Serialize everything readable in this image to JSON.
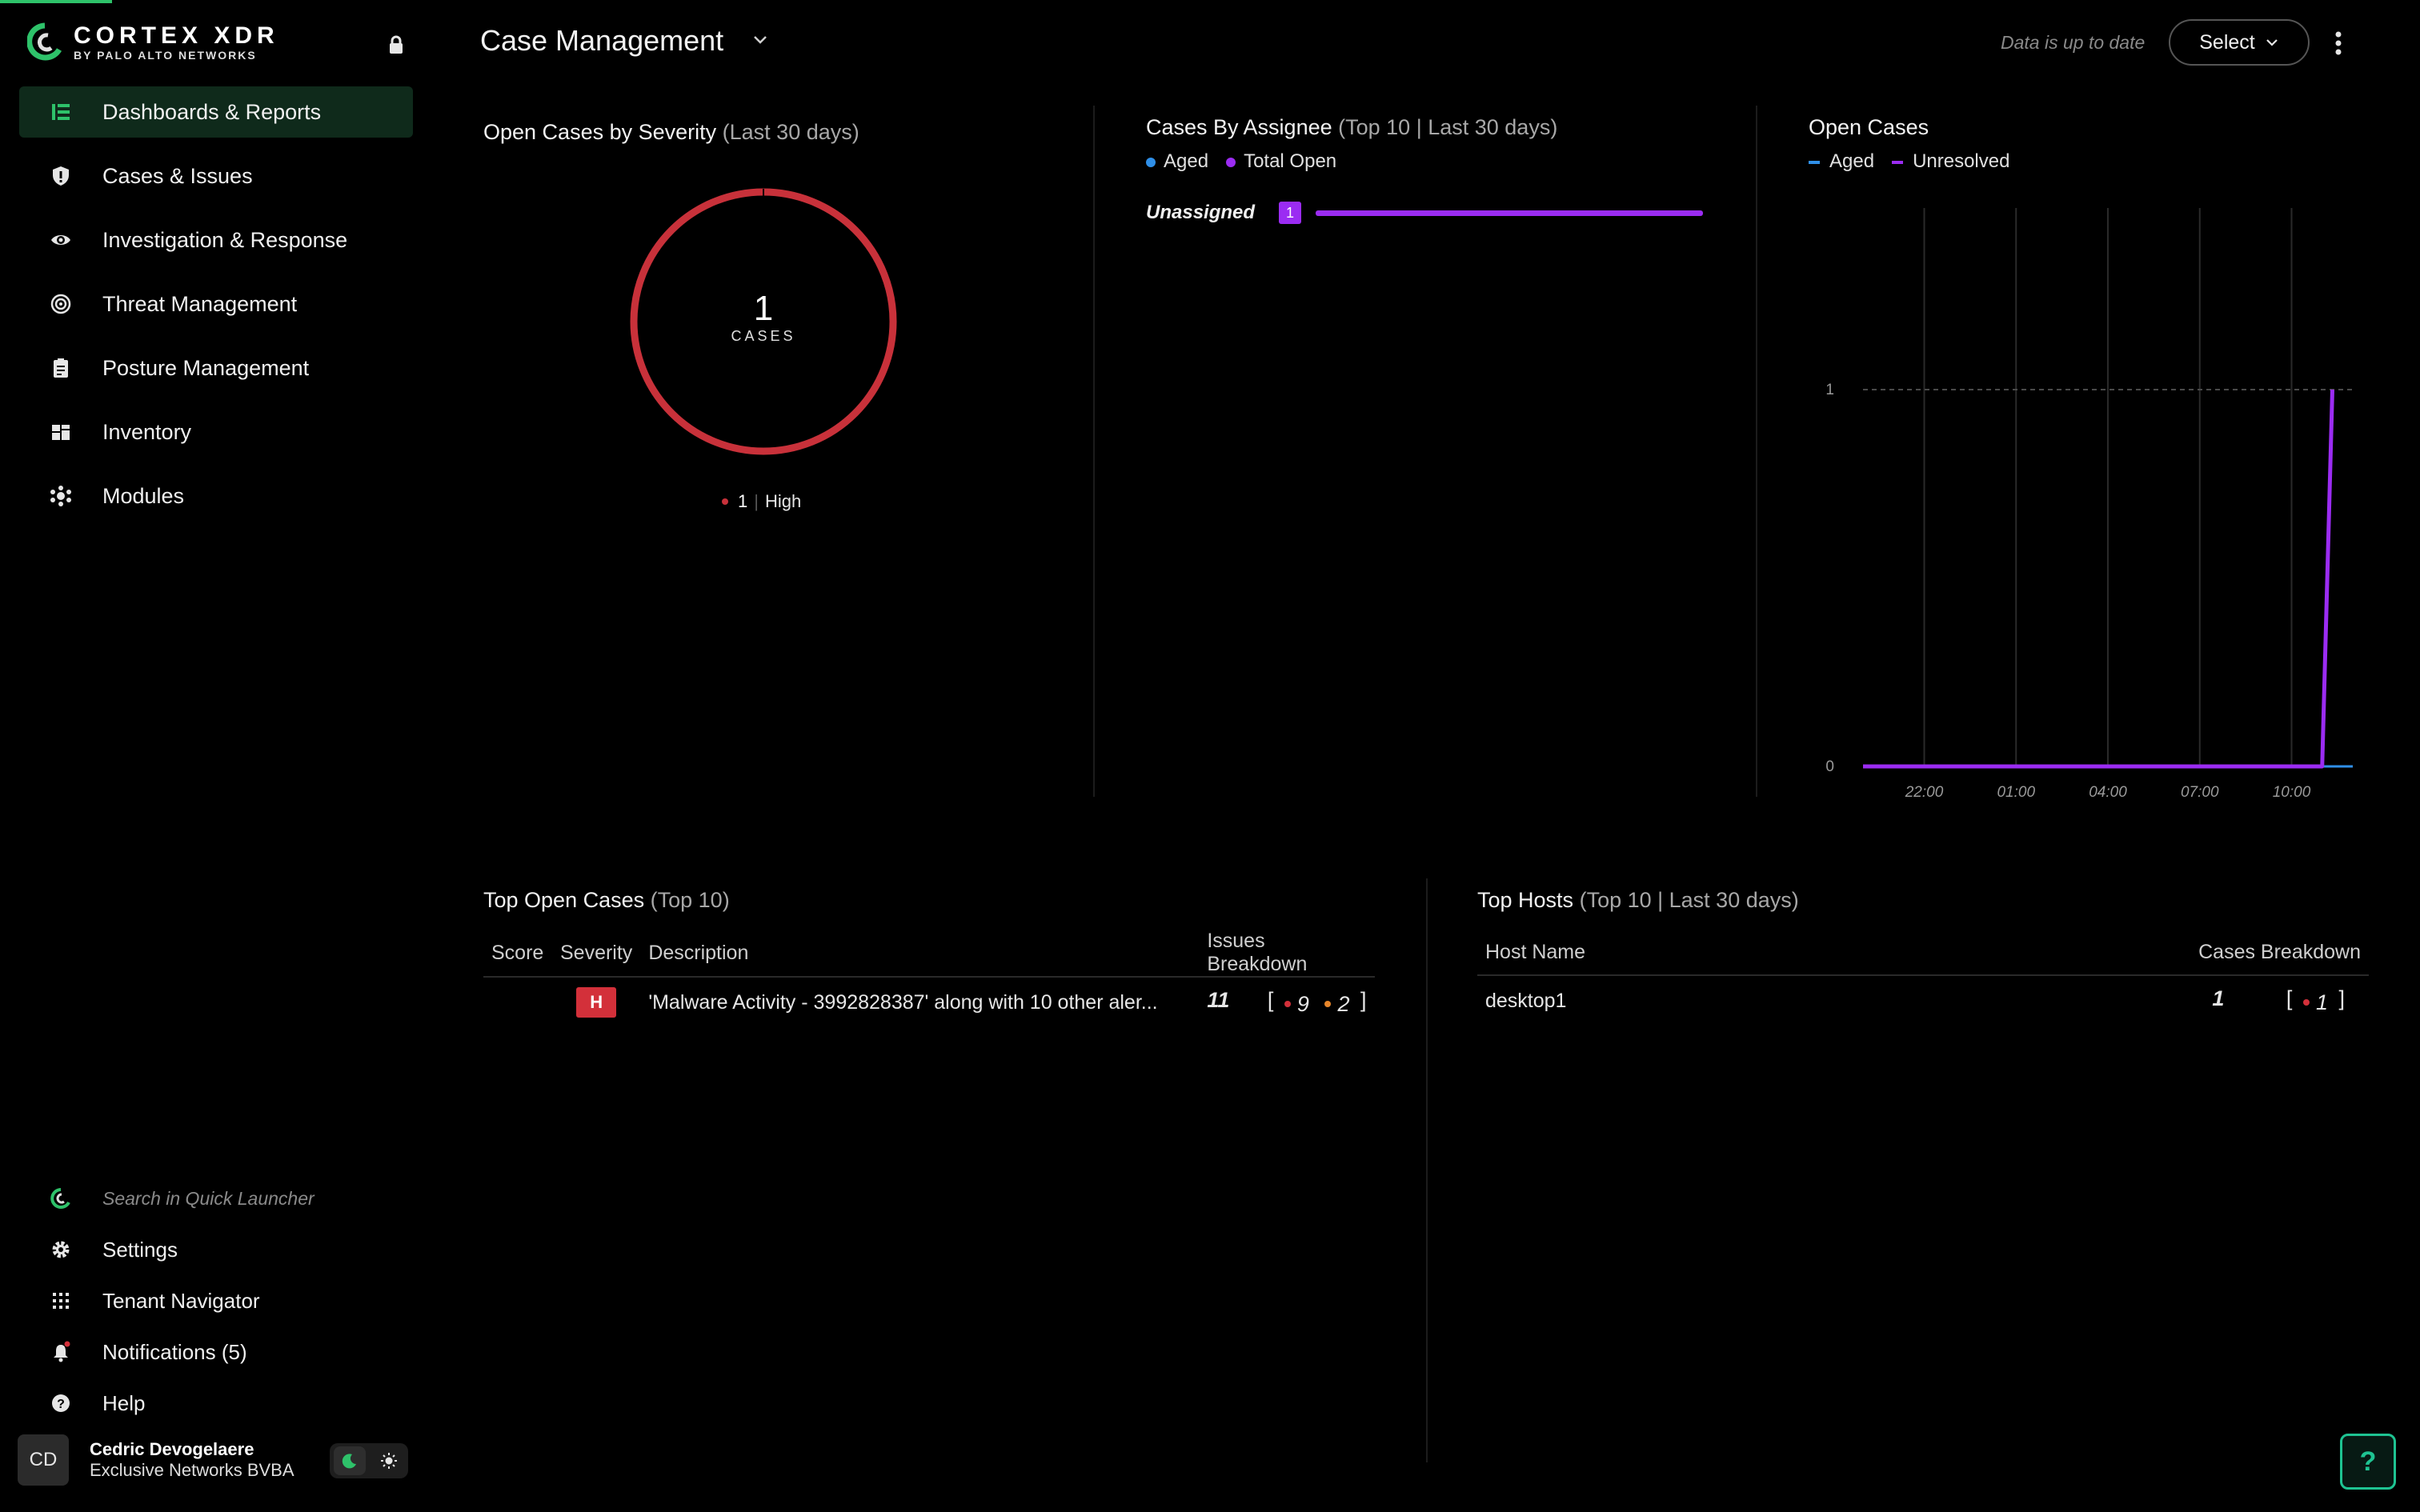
{
  "app": {
    "brand_name": "CORTEX XDR",
    "brand_sub": "BY PALO ALTO NETWORKS",
    "accent_color": "#2ec26a"
  },
  "sidebar": {
    "items": [
      {
        "label": "Dashboards & Reports",
        "icon": "dashboard-icon",
        "active": true
      },
      {
        "label": "Cases & Issues",
        "icon": "shield-alert-icon",
        "active": false
      },
      {
        "label": "Investigation & Response",
        "icon": "eye-icon",
        "active": false
      },
      {
        "label": "Threat Management",
        "icon": "target-icon",
        "active": false
      },
      {
        "label": "Posture Management",
        "icon": "clipboard-icon",
        "active": false
      },
      {
        "label": "Inventory",
        "icon": "inventory-icon",
        "active": false
      },
      {
        "label": "Modules",
        "icon": "modules-icon",
        "active": false
      }
    ],
    "bottom": {
      "quick_launcher_placeholder": "Search in Quick Launcher",
      "settings": "Settings",
      "tenant_navigator": "Tenant Navigator",
      "notifications": "Notifications (5)",
      "help": "Help"
    },
    "user": {
      "initials": "CD",
      "name": "Cedric Devogelaere",
      "org": "Exclusive Networks BVBA"
    }
  },
  "header": {
    "title": "Case Management",
    "data_status": "Data is up to date",
    "select_label": "Select"
  },
  "widgets": {
    "severity": {
      "title": "Open Cases by Severity",
      "subtitle": "(Last 30 days)",
      "count": "1",
      "count_label": "CASES",
      "legend_count": "1",
      "legend_label": "High",
      "high_color": "#c8313a"
    },
    "assignee": {
      "title": "Cases By Assignee",
      "subtitle": "(Top 10 | Last 30 days)",
      "legend": [
        {
          "label": "Aged",
          "color": "#2f8fe8"
        },
        {
          "label": "Total Open",
          "color": "#9b2cf2"
        }
      ],
      "rows": [
        {
          "name": "Unassigned",
          "count": "1"
        }
      ]
    },
    "open_cases": {
      "title": "Open Cases",
      "legend": [
        {
          "label": "Aged",
          "color": "#2f8fe8"
        },
        {
          "label": "Unresolved",
          "color": "#9b2cf2"
        }
      ]
    },
    "top_open_cases": {
      "title": "Top Open Cases",
      "subtitle": "(Top 10)",
      "columns": [
        "Score",
        "Severity",
        "Description",
        "Issues Breakdown"
      ],
      "rows": [
        {
          "score": "",
          "severity": "H",
          "description": "'Malware Activity - 3992828387' along with 10 other aler...",
          "issues_total": "11",
          "red_count": "9",
          "orange_count": "2"
        }
      ]
    },
    "top_hosts": {
      "title": "Top Hosts",
      "subtitle": "(Top 10 | Last 30 days)",
      "columns": [
        "Host Name",
        "Cases Breakdown"
      ],
      "rows": [
        {
          "host": "desktop1",
          "cases_total": "1",
          "red_count": "1"
        }
      ]
    }
  },
  "chart_data": {
    "type": "line",
    "title": "Open Cases",
    "xlabel": "",
    "ylabel": "",
    "x_ticks": [
      "22:00",
      "01:00",
      "04:00",
      "07:00",
      "10:00"
    ],
    "y_ticks": [
      "0",
      "1"
    ],
    "ylim": [
      0,
      1
    ],
    "grid": true,
    "legend_position": "top-left",
    "series": [
      {
        "name": "Aged",
        "color": "#2f8fe8",
        "x": [
          "20:00",
          "12:00"
        ],
        "values": [
          0,
          0
        ]
      },
      {
        "name": "Unresolved",
        "color": "#9b2cf2",
        "x": [
          "20:00",
          "11:00",
          "11:20"
        ],
        "values": [
          0,
          0,
          1
        ]
      }
    ]
  }
}
